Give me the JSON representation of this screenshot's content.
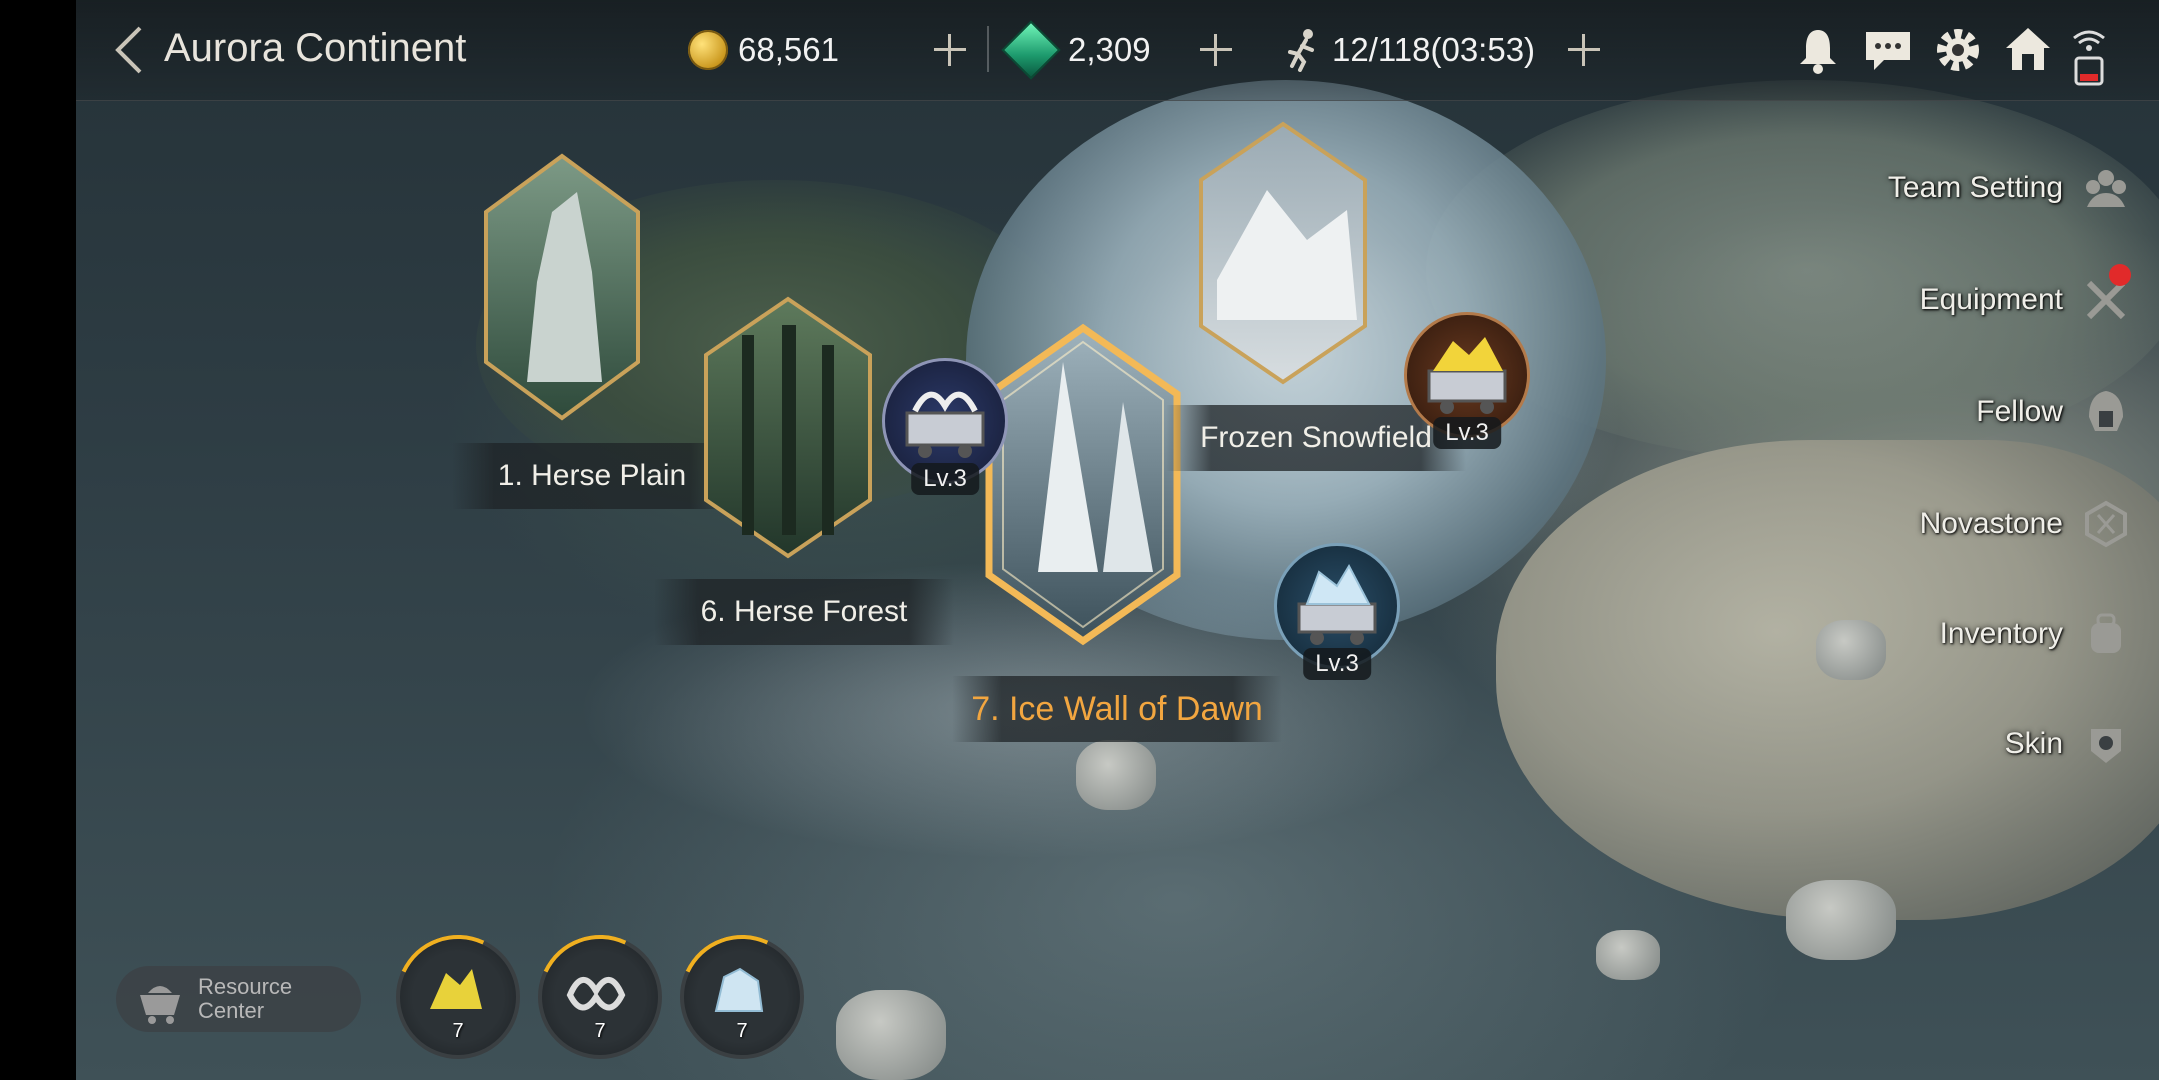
{
  "header": {
    "title": "Aurora Continent",
    "gold": "68,561",
    "gems": "2,309",
    "stamina": "12/118(03:53)"
  },
  "right_menu": [
    {
      "label": "Team Setting",
      "icon": "team-icon"
    },
    {
      "label": "Equipment",
      "icon": "crossed-swords-icon",
      "alert": true
    },
    {
      "label": "Fellow",
      "icon": "helmet-icon"
    },
    {
      "label": "Novastone",
      "icon": "hexagon-stone-icon"
    },
    {
      "label": "Inventory",
      "icon": "bag-icon"
    },
    {
      "label": "Skin",
      "icon": "armor-icon"
    }
  ],
  "stages": {
    "herse_plain": {
      "label": "1. Herse Plain"
    },
    "herse_forest": {
      "label": "6. Herse Forest"
    },
    "ice_wall": {
      "label": "7. Ice Wall of Dawn",
      "selected": true
    },
    "frozen_snowfield": {
      "label": "Frozen Snowfield"
    }
  },
  "resource_nodes": {
    "silver_cart": {
      "level": "Lv.3",
      "icon": "silver-ore-cart-icon"
    },
    "gold_cart": {
      "level": "Lv.3",
      "icon": "gold-ore-cart-icon"
    },
    "crystal_cart": {
      "level": "Lv.3",
      "icon": "crystal-ore-cart-icon"
    }
  },
  "bottom": {
    "resource_center": "Resource\nCenter",
    "gold_ore_count": "7",
    "silver_ore_count": "7",
    "crystal_count": "7"
  },
  "colors": {
    "active_stage": "#f2a640",
    "gold_frame": "#c9a25a",
    "alert": "#e12a2a"
  }
}
